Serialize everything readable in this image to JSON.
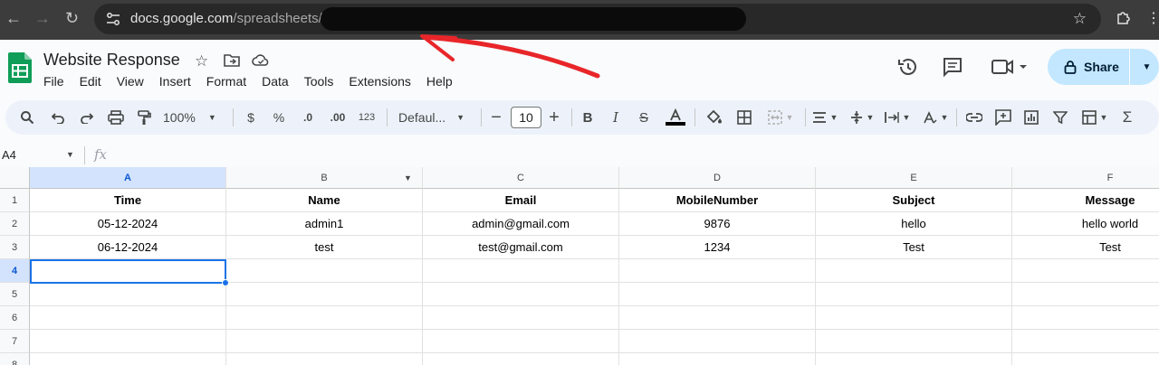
{
  "browser": {
    "url_host": "docs.google.com",
    "url_path": "/spreadsheets/d/"
  },
  "doc": {
    "title": "Website Response"
  },
  "menu": [
    "File",
    "Edit",
    "View",
    "Insert",
    "Format",
    "Data",
    "Tools",
    "Extensions",
    "Help"
  ],
  "share": {
    "label": "Share"
  },
  "toolbar": {
    "zoom": "100%",
    "currency": "$",
    "percent": "%",
    "dec_decrease": ".0",
    "dec_increase": ".00",
    "number_format": "123",
    "font": "Defaul...",
    "font_size": "10"
  },
  "formula_bar": {
    "name_box": "A4",
    "fx_label": "fx",
    "value": ""
  },
  "sheet": {
    "columns": [
      "A",
      "B",
      "C",
      "D",
      "E",
      "F"
    ],
    "row_numbers": [
      "1",
      "2",
      "3",
      "4",
      "5",
      "6",
      "7",
      "8"
    ],
    "rows": [
      [
        "Time",
        "Name",
        "Email",
        "MobileNumber",
        "Subject",
        "Message"
      ],
      [
        "05-12-2024",
        "admin1",
        "admin@gmail.com",
        "9876",
        "hello",
        "hello world"
      ],
      [
        "06-12-2024",
        "test",
        "test@gmail.com",
        "1234",
        "Test",
        "Test"
      ],
      [
        "",
        "",
        "",
        "",
        "",
        ""
      ],
      [
        "",
        "",
        "",
        "",
        "",
        ""
      ],
      [
        "",
        "",
        "",
        "",
        "",
        ""
      ],
      [
        "",
        "",
        "",
        "",
        "",
        ""
      ],
      [
        "",
        "",
        "",
        "",
        "",
        ""
      ]
    ],
    "selected_cell": "A4"
  },
  "colors": {
    "accent": "#1a73e8",
    "share_bg": "#c2e7ff",
    "annotation": "#e8262a",
    "sheets_green": "#0f9d58"
  }
}
